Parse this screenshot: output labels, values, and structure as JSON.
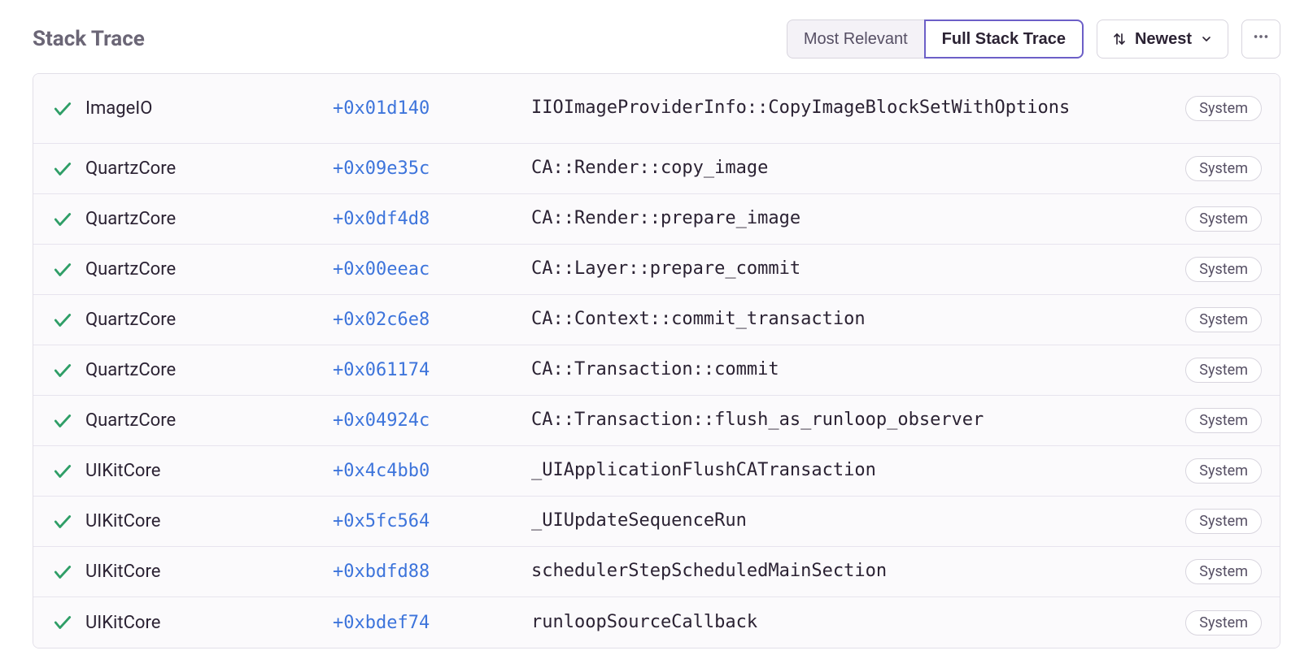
{
  "title": "Stack Trace",
  "toolbar": {
    "most_relevant": "Most Relevant",
    "full_stack": "Full Stack Trace",
    "sort_label": "Newest"
  },
  "tag_label": "System",
  "frames": [
    {
      "module": "ImageIO",
      "offset": "+0x01d140",
      "symbol": "IIOImageProviderInfo::CopyImageBlockSetWithOptions",
      "tall": true
    },
    {
      "module": "QuartzCore",
      "offset": "+0x09e35c",
      "symbol": "CA::Render::copy_image"
    },
    {
      "module": "QuartzCore",
      "offset": "+0x0df4d8",
      "symbol": "CA::Render::prepare_image"
    },
    {
      "module": "QuartzCore",
      "offset": "+0x00eeac",
      "symbol": "CA::Layer::prepare_commit"
    },
    {
      "module": "QuartzCore",
      "offset": "+0x02c6e8",
      "symbol": "CA::Context::commit_transaction"
    },
    {
      "module": "QuartzCore",
      "offset": "+0x061174",
      "symbol": "CA::Transaction::commit"
    },
    {
      "module": "QuartzCore",
      "offset": "+0x04924c",
      "symbol": "CA::Transaction::flush_as_runloop_observer"
    },
    {
      "module": "UIKitCore",
      "offset": "+0x4c4bb0",
      "symbol": "_UIApplicationFlushCATransaction"
    },
    {
      "module": "UIKitCore",
      "offset": "+0x5fc564",
      "symbol": "_UIUpdateSequenceRun"
    },
    {
      "module": "UIKitCore",
      "offset": "+0xbdfd88",
      "symbol": "schedulerStepScheduledMainSection"
    },
    {
      "module": "UIKitCore",
      "offset": "+0xbdef74",
      "symbol": "runloopSourceCallback"
    }
  ]
}
